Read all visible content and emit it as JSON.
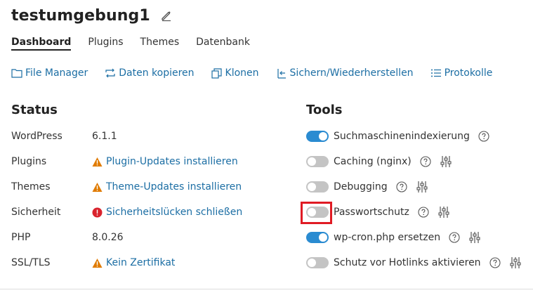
{
  "page": {
    "title": "testumgebung1"
  },
  "tabs": [
    {
      "label": "Dashboard",
      "active": true
    },
    {
      "label": "Plugins",
      "active": false
    },
    {
      "label": "Themes",
      "active": false
    },
    {
      "label": "Datenbank",
      "active": false
    }
  ],
  "actions": [
    {
      "label": "File Manager",
      "icon": "folder-icon"
    },
    {
      "label": "Daten kopieren",
      "icon": "copy-arrows-icon"
    },
    {
      "label": "Klonen",
      "icon": "clone-icon"
    },
    {
      "label": "Sichern/Wiederherstellen",
      "icon": "backup-restore-icon"
    },
    {
      "label": "Protokolle",
      "icon": "list-icon"
    }
  ],
  "status": {
    "title": "Status",
    "rows": [
      {
        "label": "WordPress",
        "value": "6.1.1",
        "kind": "text"
      },
      {
        "label": "Plugins",
        "value": "Plugin-Updates installieren",
        "kind": "warning"
      },
      {
        "label": "Themes",
        "value": "Theme-Updates installieren",
        "kind": "warning"
      },
      {
        "label": "Sicherheit",
        "value": "Sicherheitslücken schließen",
        "kind": "error"
      },
      {
        "label": "PHP",
        "value": "8.0.26",
        "kind": "text"
      },
      {
        "label": "SSL/TLS",
        "value": "Kein Zertifikat",
        "kind": "warning"
      }
    ]
  },
  "tools": {
    "title": "Tools",
    "rows": [
      {
        "label": "Suchmaschinenindexierung",
        "enabled": true,
        "has_settings": false
      },
      {
        "label": "Caching (nginx)",
        "enabled": false,
        "has_settings": true
      },
      {
        "label": "Debugging",
        "enabled": false,
        "has_settings": true
      },
      {
        "label": "Passwortschutz",
        "enabled": false,
        "has_settings": true
      },
      {
        "label": "wp-cron.php ersetzen",
        "enabled": true,
        "has_settings": true
      },
      {
        "label": "Schutz vor Hotlinks aktivieren",
        "enabled": false,
        "has_settings": true
      }
    ]
  },
  "colors": {
    "link": "#1c6ea4",
    "toggle_on": "#2a8bd1",
    "toggle_off": "#c4c4c4",
    "warning": "#e07b00",
    "error": "#d9232d",
    "highlight": "#e01b24"
  }
}
